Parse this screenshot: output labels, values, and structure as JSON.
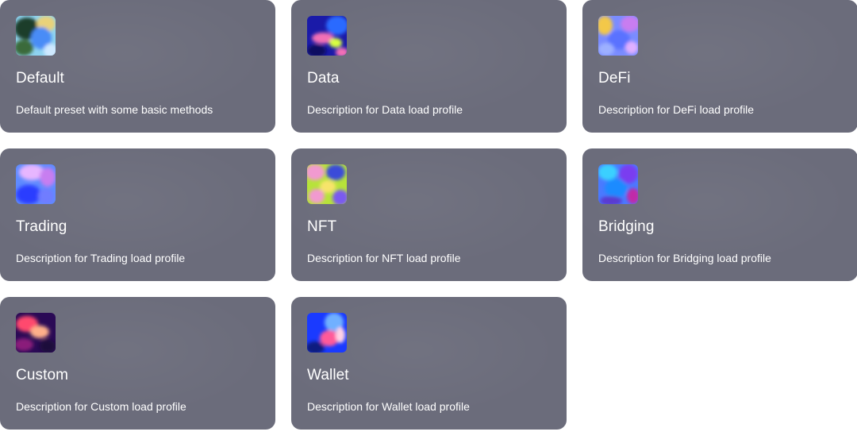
{
  "profiles": [
    {
      "id": "default",
      "title": "Default",
      "description": "Default preset with some basic methods",
      "icon": "default-art-icon",
      "colors": [
        "#1f3c2a",
        "#4a8cf7",
        "#9fd0f5",
        "#e9d27a"
      ]
    },
    {
      "id": "data",
      "title": "Data",
      "description": "Description for Data load profile",
      "icon": "data-art-icon",
      "colors": [
        "#1a1aa8",
        "#2b6bff",
        "#f26fb6",
        "#d9ff3f"
      ]
    },
    {
      "id": "defi",
      "title": "DeFi",
      "description": "Description for DeFi load profile",
      "icon": "defi-art-icon",
      "colors": [
        "#f3c84a",
        "#5a72ff",
        "#c87df0",
        "#7aa0ff"
      ]
    },
    {
      "id": "trading",
      "title": "Trading",
      "description": "Description for Trading load profile",
      "icon": "trading-art-icon",
      "colors": [
        "#2a3cff",
        "#5f8bff",
        "#c77ef0",
        "#e7b6ff"
      ]
    },
    {
      "id": "nft",
      "title": "NFT",
      "description": "Description for NFT load profile",
      "icon": "nft-art-icon",
      "colors": [
        "#f19ad0",
        "#b7e33a",
        "#3b4bd9",
        "#f7e46a"
      ]
    },
    {
      "id": "bridging",
      "title": "Bridging",
      "description": "Description for Bridging load profile",
      "icon": "bridging-art-icon",
      "colors": [
        "#1f8bff",
        "#7a3df0",
        "#c02aa8",
        "#3bd0ff"
      ]
    },
    {
      "id": "custom",
      "title": "Custom",
      "description": "Description for Custom load profile",
      "icon": "custom-art-icon",
      "colors": [
        "#2a0a55",
        "#ff4a6e",
        "#ffb08a",
        "#8a1e7a"
      ]
    },
    {
      "id": "wallet",
      "title": "Wallet",
      "description": "Description for Wallet load profile",
      "icon": "wallet-art-icon",
      "colors": [
        "#1a3aff",
        "#ff5a9a",
        "#6fb0ff",
        "#ffd2e6"
      ]
    }
  ]
}
